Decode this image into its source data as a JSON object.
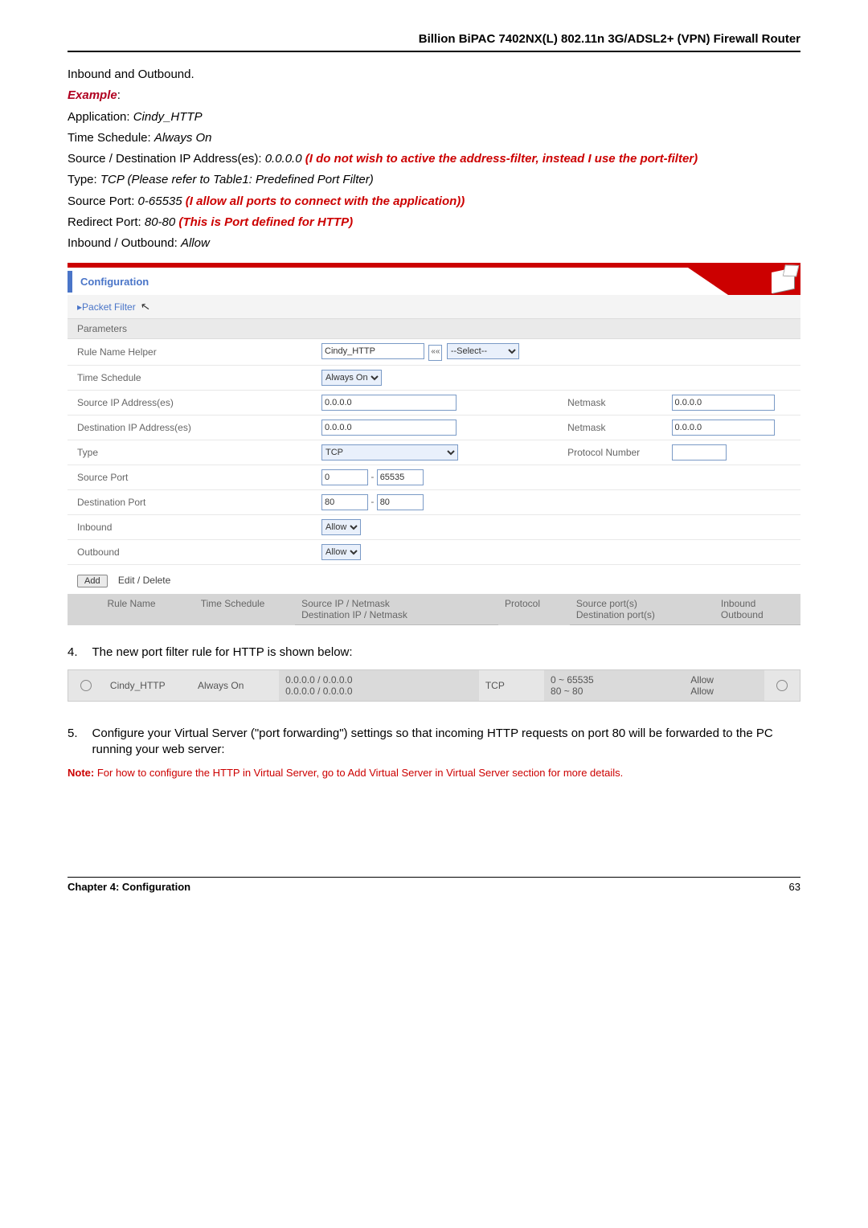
{
  "header": {
    "title": "Billion BiPAC 7402NX(L) 802.11n 3G/ADSL2+ (VPN) Firewall Router"
  },
  "intro": "Inbound and Outbound.",
  "example_label": "Example",
  "app_line": {
    "label": "Application: ",
    "value": "Cindy_HTTP"
  },
  "ts_line": {
    "label": "Time Schedule: ",
    "value": "Always On"
  },
  "sd_line": {
    "label": "Source / Destination IP Address(es): ",
    "value": "0.0.0.0 ",
    "red": "(I do not wish to active the address-filter, instead I use the port-filter)"
  },
  "type_line": {
    "label": "Type: ",
    "value": "TCP (Please refer to Table1: Predefined Port Filter)"
  },
  "sp_line": {
    "label": "Source Port: ",
    "value": "0-65535 ",
    "red": "(I allow all ports to connect with the application))"
  },
  "rp_line": {
    "label": "Redirect Port: ",
    "value": "80-80 ",
    "red": "(This is Port defined for HTTP)"
  },
  "io_line": {
    "label": "Inbound / Outbound: ",
    "value": "Allow"
  },
  "config": {
    "title": "Configuration",
    "section": "▸Packet Filter",
    "params": "Parameters",
    "rows": {
      "rule_helper": {
        "label": "Rule Name  Helper",
        "value": "Cindy_HTTP",
        "select": "--Select--"
      },
      "time_schedule": {
        "label": "Time Schedule",
        "value": "Always On"
      },
      "src_ip": {
        "label": "Source IP Address(es)",
        "value": "0.0.0.0",
        "netmask_label": "Netmask",
        "netmask": "0.0.0.0"
      },
      "dst_ip": {
        "label": "Destination IP Address(es)",
        "value": "0.0.0.0",
        "netmask_label": "Netmask",
        "netmask": "0.0.0.0"
      },
      "type": {
        "label": "Type",
        "value": "TCP",
        "pn_label": "Protocol Number"
      },
      "src_port": {
        "label": "Source Port",
        "from": "0",
        "to": "65535"
      },
      "dst_port": {
        "label": "Destination Port",
        "from": "80",
        "to": "80"
      },
      "inbound": {
        "label": "Inbound",
        "value": "Allow"
      },
      "outbound": {
        "label": "Outbound",
        "value": "Allow"
      }
    },
    "actions": {
      "add": "Add",
      "editdel": "Edit / Delete"
    },
    "rules_head": {
      "rule_name": "Rule Name",
      "time_schedule": "Time Schedule",
      "src_ip": "Source IP / Netmask",
      "dst_ip": "Destination IP / Netmask",
      "protocol": "Protocol",
      "src_ports": "Source port(s)",
      "dst_ports": "Destination port(s)",
      "inbound": "Inbound",
      "outbound": "Outbound"
    }
  },
  "step4": {
    "num": "4.",
    "text": "The new port filter rule for HTTP is shown below:"
  },
  "result": {
    "name": "Cindy_HTTP",
    "ts": "Always On",
    "ip1": "0.0.0.0 / 0.0.0.0",
    "ip2": "0.0.0.0 / 0.0.0.0",
    "proto": "TCP",
    "p1": "0 ~ 65535",
    "p2": "80 ~ 80",
    "io1": "Allow",
    "io2": "Allow"
  },
  "step5": {
    "num": "5.",
    "text": "Configure your Virtual Server (\"port forwarding\") settings so that incoming HTTP requests on port 80 will be forwarded to the PC running your web server:"
  },
  "note": {
    "label": "Note:",
    "text": " For how to configure the HTTP in Virtual Server, go to Add Virtual Server in Virtual Server section for more details."
  },
  "footer": {
    "chapter": "Chapter 4: Configuration",
    "page": "63"
  }
}
